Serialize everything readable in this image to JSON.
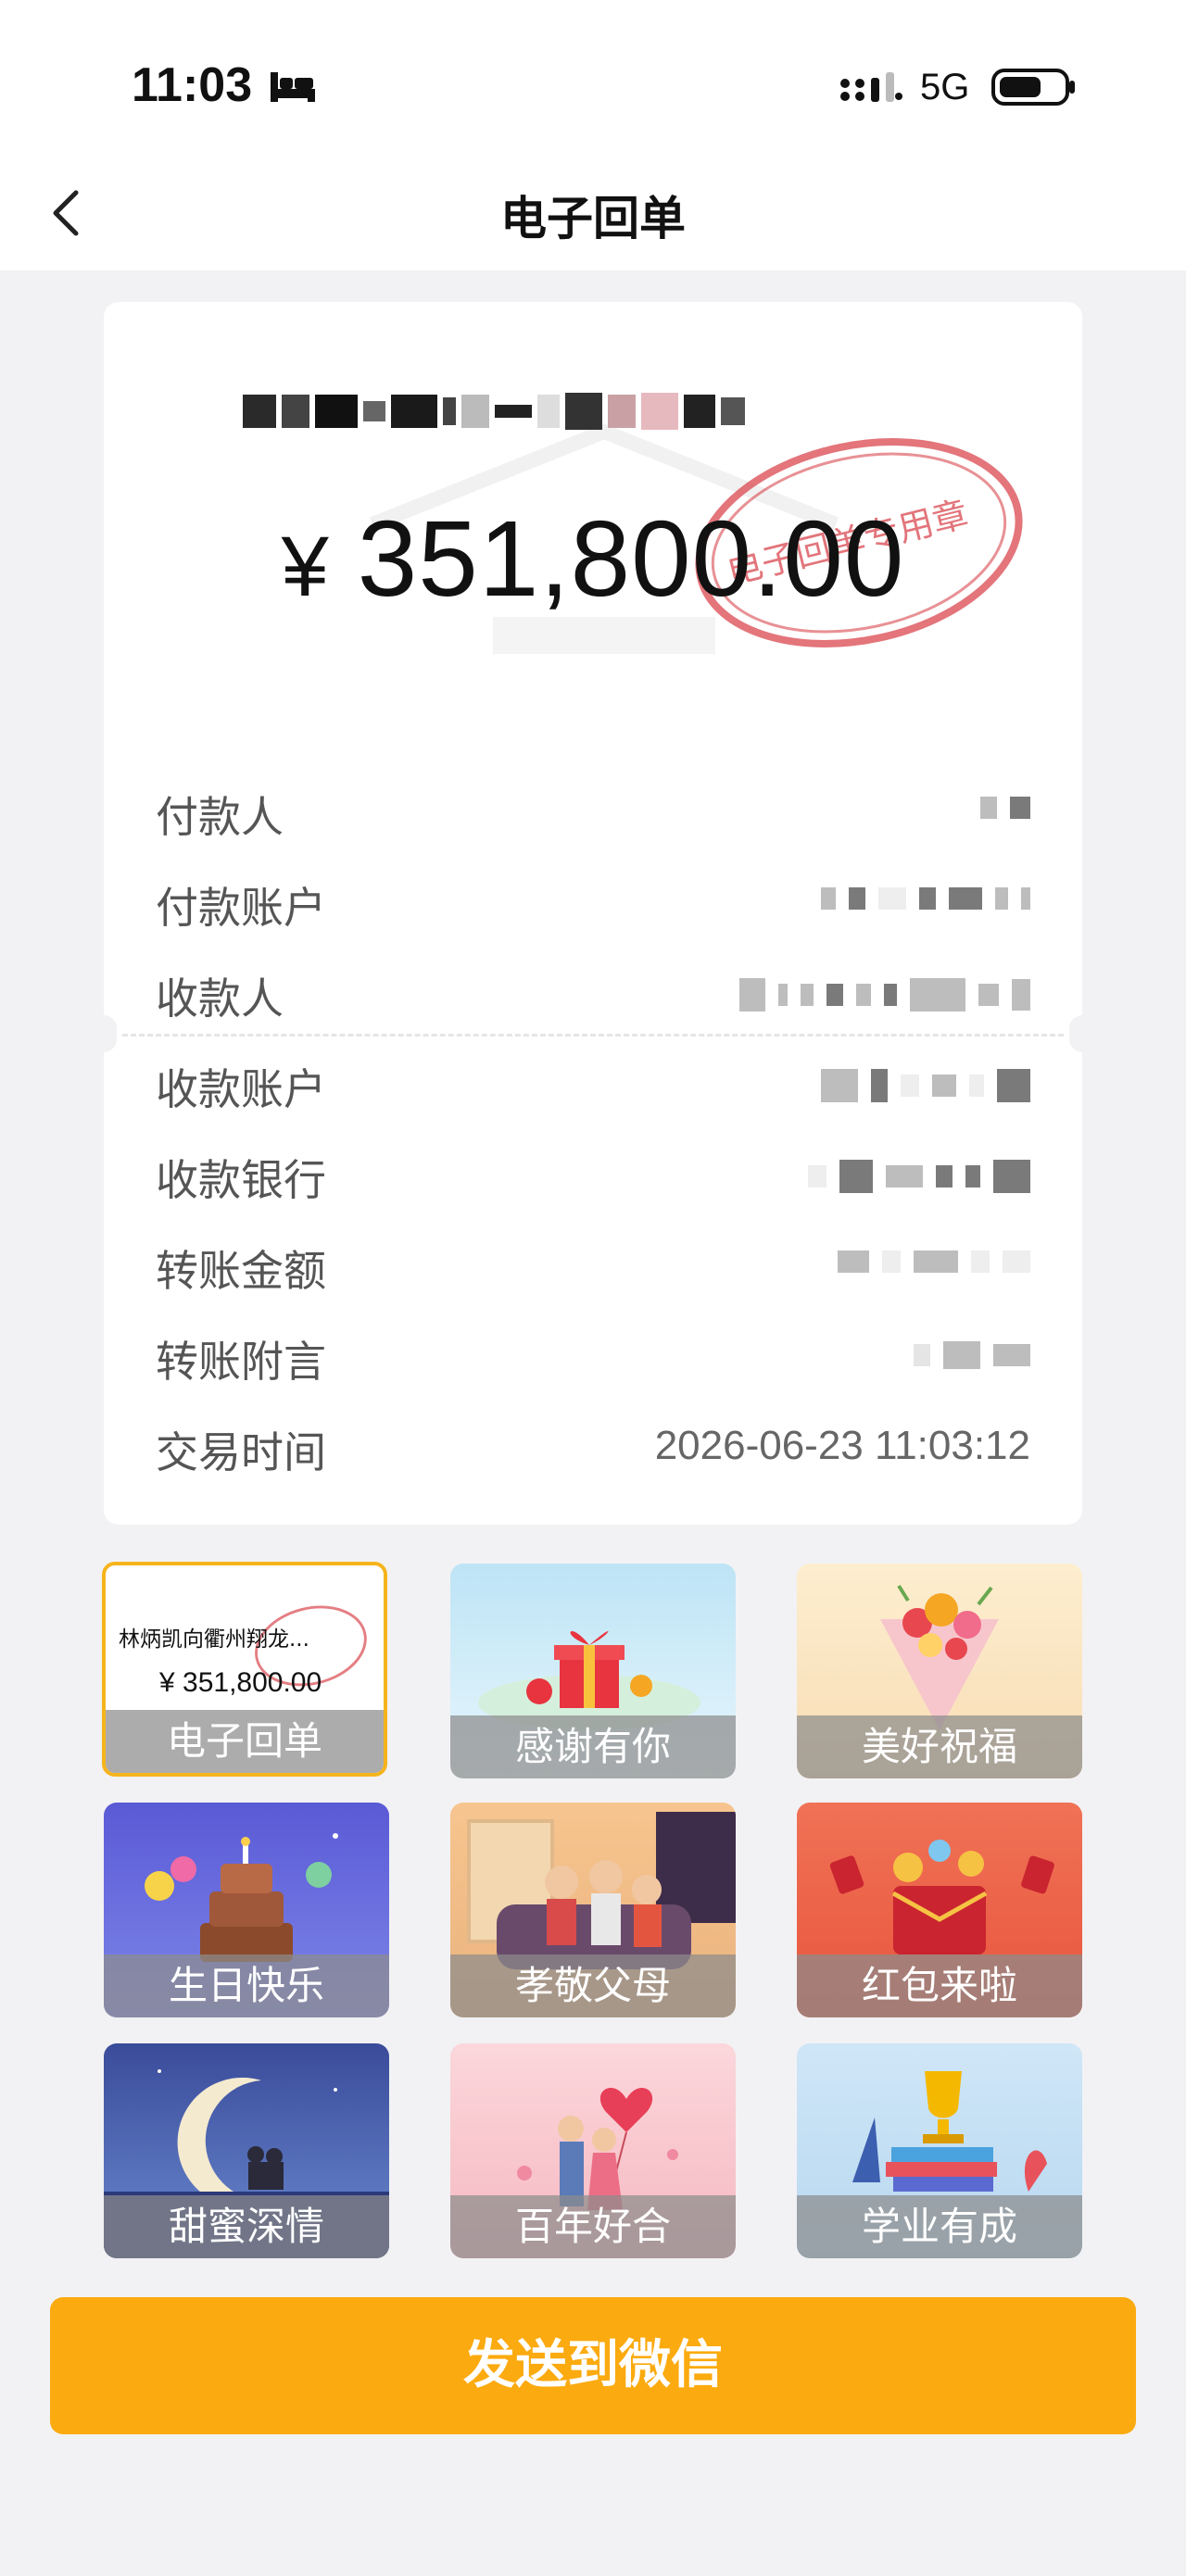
{
  "status_bar": {
    "time": "11:03",
    "network": "5G",
    "icons": [
      "bed-icon",
      "signal-icon",
      "battery-icon"
    ]
  },
  "nav": {
    "title": "电子回单",
    "back_icon": "chevron-left-icon"
  },
  "receipt": {
    "amount_symbol": "¥",
    "amount": "351,800.00",
    "stamp_text": "电子回单专用章",
    "fields": [
      {
        "label": "付款人",
        "value": ""
      },
      {
        "label": "付款账户",
        "value": ""
      },
      {
        "label": "收款人",
        "value": ""
      },
      {
        "label": "收款账户",
        "value": ""
      },
      {
        "label": "收款银行",
        "value": ""
      },
      {
        "label": "转账金额",
        "value": ""
      },
      {
        "label": "转账附言",
        "value": ""
      },
      {
        "label": "交易时间",
        "value": "2026-06-23 11:03:12"
      }
    ]
  },
  "templates": {
    "selected_preview": {
      "name": "林炳凯向衢州翔龙...",
      "amount": "¥ 351,800.00"
    },
    "items": [
      {
        "label": "电子回单"
      },
      {
        "label": "感谢有你"
      },
      {
        "label": "美好祝福"
      },
      {
        "label": "生日快乐"
      },
      {
        "label": "孝敬父母"
      },
      {
        "label": "红包来啦"
      },
      {
        "label": "甜蜜深情"
      },
      {
        "label": "百年好合"
      },
      {
        "label": "学业有成"
      }
    ]
  },
  "colors": {
    "accent": "#fbaa0f",
    "selected_border": "#f6b41c",
    "stamp_red": "#d9474f",
    "background": "#f2f2f4"
  },
  "send_button": {
    "label": "发送到微信"
  }
}
